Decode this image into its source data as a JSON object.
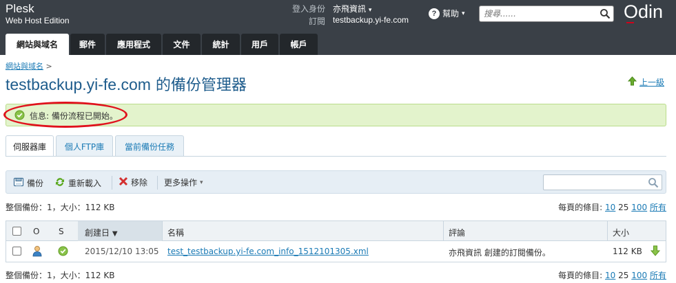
{
  "header": {
    "brand_name": "Plesk",
    "brand_edition": "Web Host Edition",
    "login_label": "登入身份",
    "login_user": "亦飛資訊",
    "subscription_label": "訂閱",
    "subscription_value": "testbackup.yi-fe.com",
    "help_label": "幫助",
    "search_placeholder": "搜尋......",
    "vendor_logo": "Odin"
  },
  "tabs": [
    {
      "label": "網站與域名",
      "active": true
    },
    {
      "label": "郵件"
    },
    {
      "label": "應用程式"
    },
    {
      "label": "文件"
    },
    {
      "label": "統計"
    },
    {
      "label": "用戶"
    },
    {
      "label": "帳戶"
    }
  ],
  "breadcrumb": {
    "item": "網站與域名",
    "separator": ">"
  },
  "page": {
    "title_host": "testbackup.yi-fe.com",
    "title_suffix": " 的備份管理器",
    "up_level": "上一級"
  },
  "message": {
    "text": "信息: 備份流程已開始。",
    "status_color": "#5aa81e",
    "highlight_color": "#e0121d"
  },
  "subtabs": [
    {
      "label": "伺服器庫",
      "active": true
    },
    {
      "label": "個人FTP庫"
    },
    {
      "label": "當前備份任務"
    }
  ],
  "toolbar": {
    "backup": "備份",
    "reload": "重新載入",
    "remove": "移除",
    "more": "更多操作"
  },
  "summary": {
    "text": "整個備份：1，大小：112 KB"
  },
  "perpage": {
    "label": "每頁的條目:",
    "opt_10": "10",
    "opt_25": "25",
    "opt_100": "100",
    "opt_all": "所有"
  },
  "table": {
    "headers": {
      "o": "O",
      "s": "S",
      "created": "創建日",
      "name": "名稱",
      "comment": "評論",
      "size": "大小"
    },
    "rows": [
      {
        "created": "2015/12/10 13:05",
        "name": "test_testbackup.yi-fe.com_info_1512101305.xml",
        "comment": "亦飛資訊 創建的訂閱備份。",
        "size": "112 KB"
      }
    ]
  },
  "colors": {
    "header_bg": "#3a4047",
    "tab_bg": "#23272b",
    "link": "#1a7ab5",
    "title": "#1e5c8c",
    "message_bg": "#e3f3cc"
  }
}
